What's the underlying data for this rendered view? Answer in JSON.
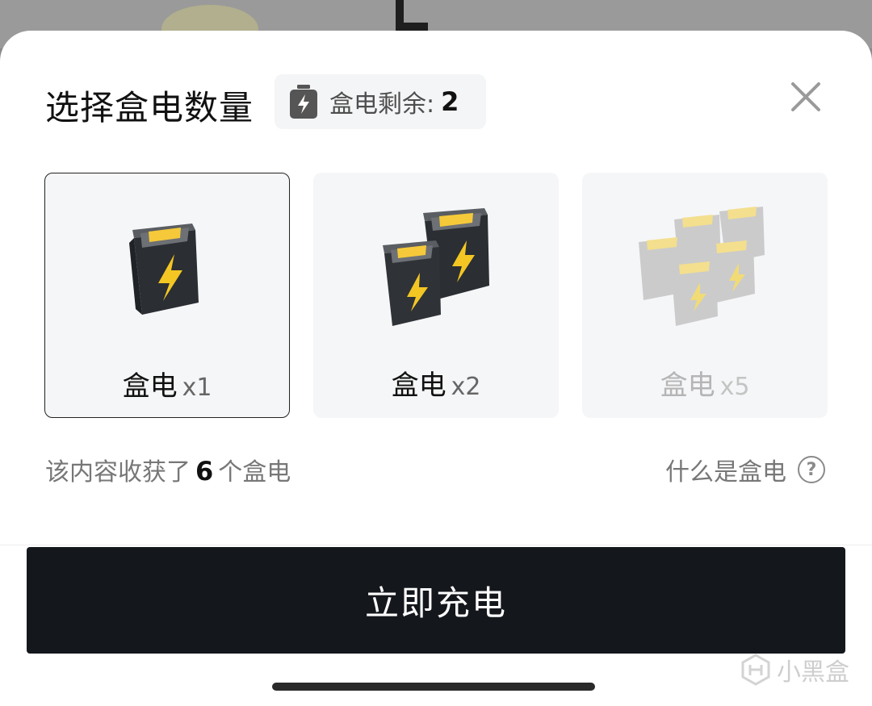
{
  "header": {
    "title": "选择盒电数量",
    "remain_label": "盒电剩余:",
    "remain_count": "2"
  },
  "options": [
    {
      "name": "盒电",
      "multiplier": "x1",
      "state": "selected"
    },
    {
      "name": "盒电",
      "multiplier": "x2",
      "state": "enabled"
    },
    {
      "name": "盒电",
      "multiplier": "x5",
      "state": "disabled"
    }
  ],
  "info": {
    "harvest_prefix": "该内容收获了",
    "harvest_count": "6",
    "harvest_suffix": "个盒电",
    "what_is": "什么是盒电",
    "help_glyph": "?"
  },
  "cta": {
    "label": "立即充电"
  },
  "watermark": {
    "text": "小黑盒"
  },
  "icons": [
    "battery-icon",
    "close-icon",
    "help-icon"
  ],
  "colors": {
    "cta_bg": "#14171c",
    "battery_dark": "#2b2e33",
    "battery_gray": "#b9b9b9",
    "battery_top": "#f5c93a",
    "bolt": "#f3c623"
  }
}
